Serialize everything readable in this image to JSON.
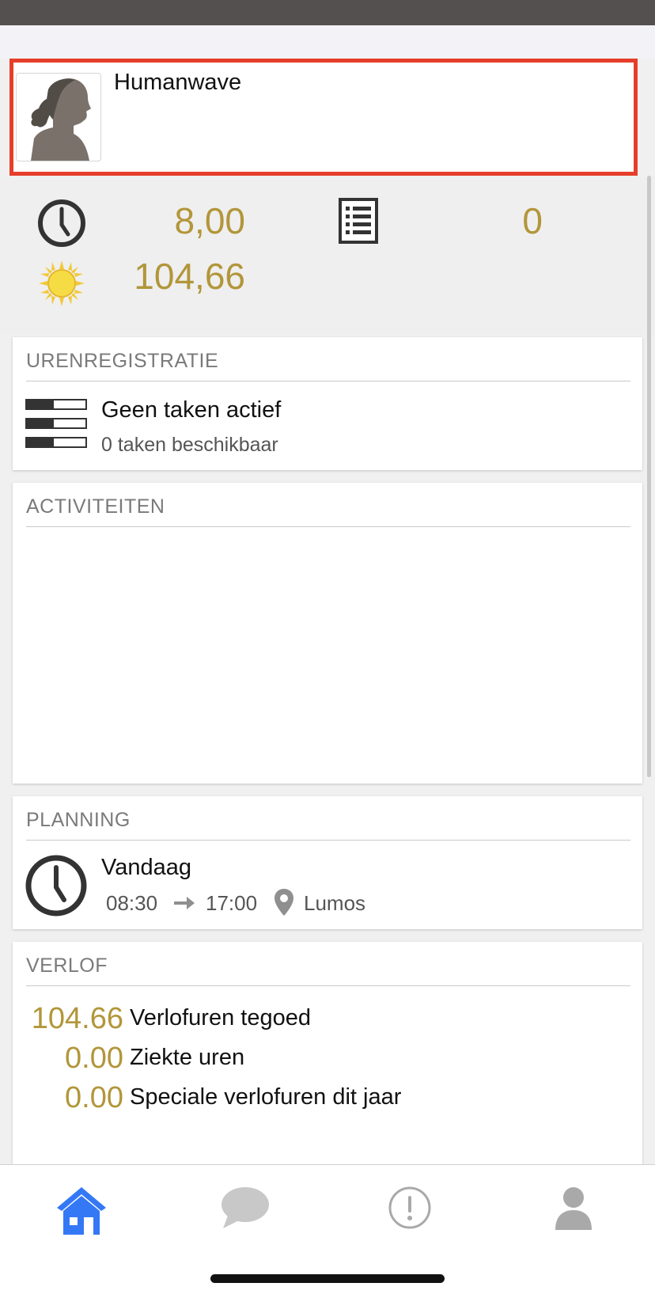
{
  "profile": {
    "name": "Humanwave"
  },
  "stats": {
    "hours_today": "8,00",
    "tasks_count": "0",
    "vacation_hours": "104,66"
  },
  "hours_card": {
    "title": "URENREGISTRATIE",
    "status": "Geen taken actief",
    "available": "0 taken beschikbaar"
  },
  "activities_card": {
    "title": "ACTIVITEITEN"
  },
  "planning_card": {
    "title": "PLANNING",
    "day": "Vandaag",
    "start": "08:30",
    "end": "17:00",
    "location": "Lumos"
  },
  "leave_card": {
    "title": "VERLOF",
    "rows": [
      {
        "value": "104.66",
        "label": "Verlofuren tegoed"
      },
      {
        "value": "0.00",
        "label": "Ziekte uren"
      },
      {
        "value": "0.00",
        "label": "Speciale verlofuren dit jaar"
      }
    ]
  },
  "nav": {
    "items": [
      "home-icon",
      "chat-icon",
      "alert-icon",
      "person-icon"
    ],
    "active": "home-icon"
  },
  "colors": {
    "accent": "#b2963a",
    "highlight": "#e63e2a",
    "nav_active": "#3478f6",
    "nav_inactive": "#a9a9a9"
  }
}
